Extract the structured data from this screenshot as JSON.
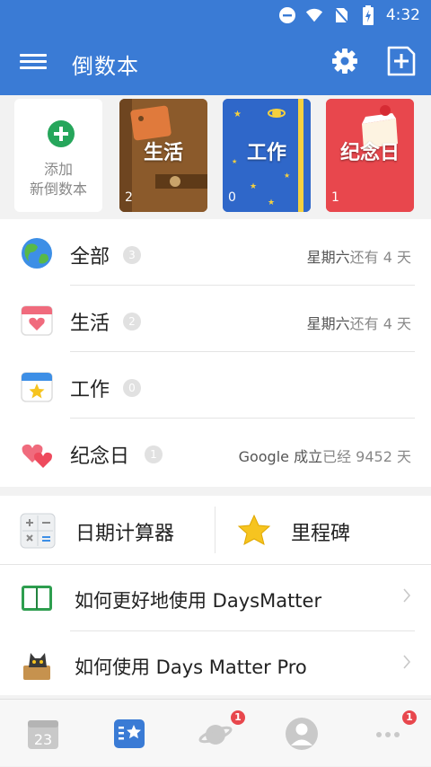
{
  "status_bar": {
    "time": "4:32"
  },
  "app_bar": {
    "title": "倒数本",
    "icons": [
      "menu-icon",
      "gear-icon",
      "add-book-icon"
    ]
  },
  "books": [
    {
      "label": "添加\n新倒数本",
      "type": "add"
    },
    {
      "label": "生活",
      "count": "2"
    },
    {
      "label": "工作",
      "count": "0"
    },
    {
      "label": "纪念日",
      "count": "1"
    }
  ],
  "add_book": {
    "line1": "添加",
    "line2": "新倒数本"
  },
  "categories": [
    {
      "name": "全部",
      "count": "3",
      "event": "星期六",
      "suffix": "还有 4 天",
      "icon": "globe-icon"
    },
    {
      "name": "生活",
      "count": "2",
      "event": "星期六",
      "suffix": "还有 4 天",
      "icon": "heart-calendar-icon"
    },
    {
      "name": "工作",
      "count": "0",
      "event": "",
      "suffix": "",
      "icon": "star-calendar-icon"
    },
    {
      "name": "纪念日",
      "count": "1",
      "event": "Google 成立",
      "suffix": "已经 9452 天",
      "icon": "hearts-icon"
    }
  ],
  "tools": {
    "calculator": "日期计算器",
    "milestone": "里程碑"
  },
  "help": [
    {
      "text": "如何更好地使用 DaysMatter",
      "icon": "book-icon"
    },
    {
      "text": "如何使用 Days Matter Pro",
      "icon": "cat-icon"
    }
  ],
  "bottom_nav": [
    {
      "icon": "calendar-23-icon",
      "calendar_day": "23"
    },
    {
      "icon": "starred-list-icon"
    },
    {
      "icon": "planet-icon",
      "badge": "1"
    },
    {
      "icon": "avatar-icon"
    },
    {
      "icon": "more-icon",
      "badge": "1"
    }
  ],
  "colors": {
    "primary": "#3a7bd5",
    "green": "#26a65b",
    "red": "#e8474d"
  }
}
